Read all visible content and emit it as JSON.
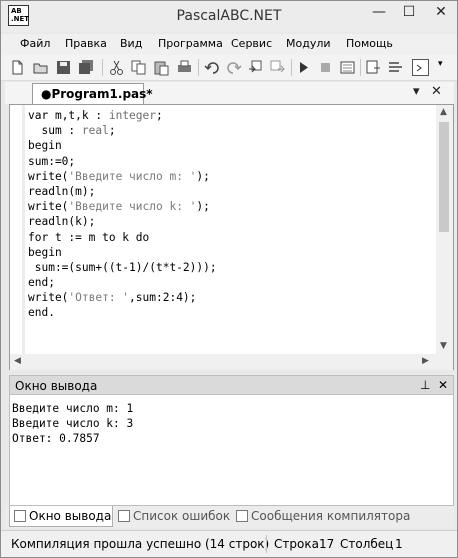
{
  "window": {
    "title": "PascalABC.NET",
    "icon_label_top": "AB",
    "icon_label_bottom": ".NET"
  },
  "window_controls": {
    "minimize": "—",
    "maximize": "☐",
    "close": "✕"
  },
  "menu": {
    "items": [
      "Файл",
      "Правка",
      "Вид",
      "Программа",
      "Сервис",
      "Модули",
      "Помощь"
    ]
  },
  "toolbar": {
    "icons": [
      "new-file-icon",
      "open-folder-icon",
      "save-icon",
      "save-all-icon",
      "cut-icon",
      "copy-icon",
      "paste-icon",
      "print-icon",
      "undo-icon",
      "redo-icon",
      "indent-icon",
      "outdent-icon",
      "run-icon",
      "stop-icon",
      "debug-icon",
      "step-icon",
      "step-into-icon",
      "output-window-icon"
    ]
  },
  "doc_tab": {
    "label": "●Program1.pas*",
    "dropdown": "▾",
    "close": "✕"
  },
  "editor": {
    "lines": [
      "var m,t,k : integer;",
      "  sum : real;",
      "begin",
      "sum:=0;",
      "write('Введите число m: ');",
      "readln(m);",
      "write('Введите число k: ');",
      "readln(k);",
      "for t := m to k do",
      "begin",
      " sum:=(sum+((t-1)/(t*t-2)));",
      "end;",
      "write('Ответ: ',sum:2:4);",
      "end."
    ]
  },
  "output_panel": {
    "title": "Окно вывода",
    "pin": "⊥",
    "close": "✕",
    "lines": [
      "Введите число m: 1",
      "Введите число k: 3",
      "Ответ: 0.7857"
    ]
  },
  "bottom_tabs": [
    "Окно вывода",
    "Список ошибок",
    "Сообщения компилятора"
  ],
  "status": {
    "message": "Компиляция прошла успешно (14 строк)",
    "row_label": "Строка",
    "row_value": "17",
    "col_label": "Столбец",
    "col_value": "1"
  },
  "colors": {
    "string_literal": "#7a7a7a",
    "keyword": "#000000",
    "type_name": "#6e6e6e"
  }
}
